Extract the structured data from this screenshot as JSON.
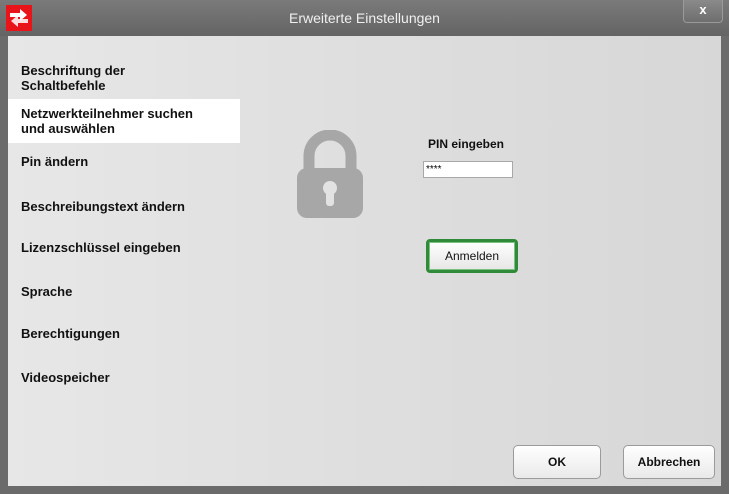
{
  "window": {
    "title": "Erweiterte Einstellungen",
    "close_label": "x"
  },
  "nav": {
    "items": [
      {
        "label_line1": "Beschriftung der",
        "label_line2": "Schaltbefehle"
      },
      {
        "label_line1": "Netzwerkteilnehmer suchen",
        "label_line2": "und auswählen"
      },
      {
        "label_line1": "Pin ändern"
      },
      {
        "label_line1": "Beschreibungstext ändern"
      },
      {
        "label_line1": "Lizenzschlüssel eingeben"
      },
      {
        "label_line1": "Sprache"
      },
      {
        "label_line1": "Berechtigungen"
      },
      {
        "label_line1": "Videospeicher"
      }
    ],
    "active_index": 1
  },
  "pin": {
    "label": "PIN eingeben",
    "value": "****"
  },
  "login_button": "Anmelden",
  "buttons": {
    "ok": "OK",
    "cancel": "Abbrechen"
  },
  "icons": {
    "app_logo": "app-logo-icon",
    "lock": "lock-icon",
    "close": "close-icon"
  },
  "colors": {
    "logo_red": "#e8141a",
    "focus_green": "#2f8a3a",
    "lock_gray": "#a7a7a7"
  }
}
